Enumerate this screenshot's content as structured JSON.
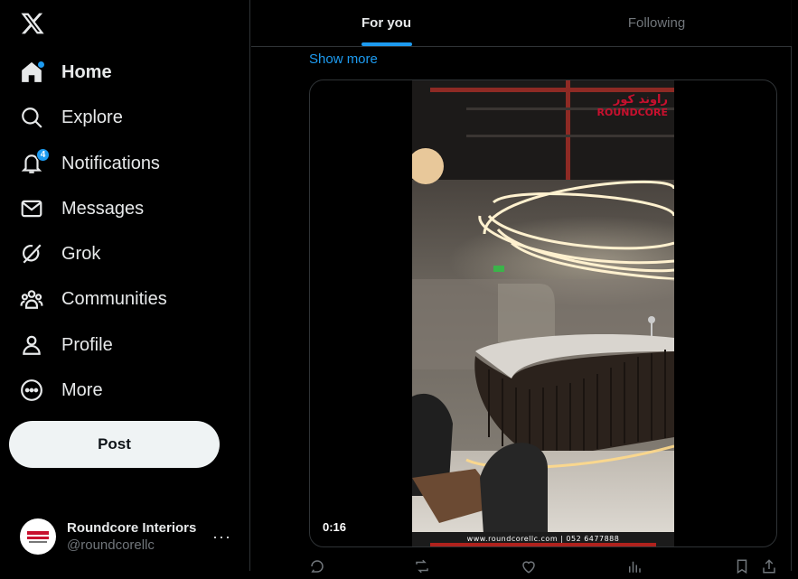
{
  "sidebar": {
    "items": [
      {
        "label": "Home",
        "icon": "home-icon"
      },
      {
        "label": "Explore",
        "icon": "search-icon"
      },
      {
        "label": "Notifications",
        "icon": "bell-icon",
        "badge": "4"
      },
      {
        "label": "Messages",
        "icon": "envelope-icon"
      },
      {
        "label": "Grok",
        "icon": "grok-icon"
      },
      {
        "label": "Communities",
        "icon": "people-icon"
      },
      {
        "label": "Profile",
        "icon": "person-icon"
      },
      {
        "label": "More",
        "icon": "more-circle-icon"
      }
    ],
    "post_label": "Post",
    "account": {
      "name": "Roundcore Interiors",
      "handle": "@roundcorellc",
      "more": "···"
    }
  },
  "tabs": [
    {
      "label": "For you",
      "active": true
    },
    {
      "label": "Following",
      "active": false
    }
  ],
  "tweet": {
    "show_more": "Show more",
    "video": {
      "duration": "0:16",
      "brand_arabic": "راوند كور",
      "brand_latin": "ROUNDCORE",
      "footer": "www.roundcorellc.com | 052 6477888"
    }
  },
  "colors": {
    "accent": "#1d9bf0",
    "background": "#000000",
    "text": "#e7e9ea",
    "muted": "#71767b",
    "border": "#2f3336"
  }
}
